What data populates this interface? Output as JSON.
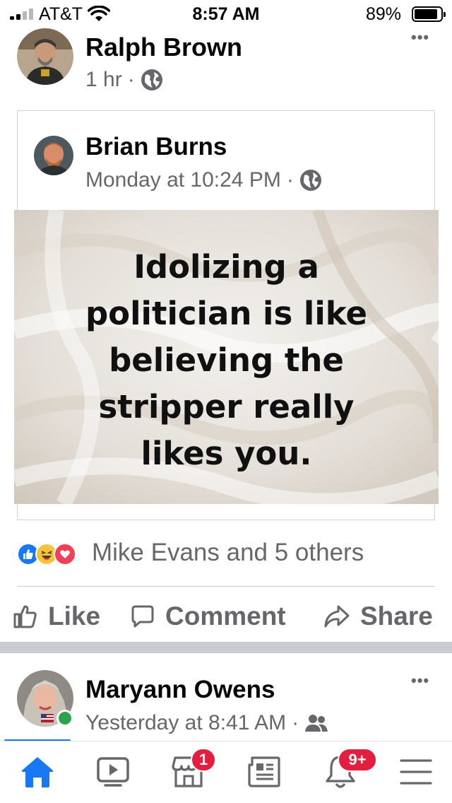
{
  "status_bar": {
    "carrier": "AT&T",
    "time": "8:57 AM",
    "battery_percent": "89%",
    "battery_level": 0.89,
    "signal_bars": 2
  },
  "post": {
    "author": "Ralph Brown",
    "timestamp": "1 hr",
    "separator": "·",
    "audience_icon": "globe-icon",
    "more_label": "•••",
    "shared": {
      "author": "Brian Burns",
      "timestamp": "Monday at 10:24 PM",
      "separator": "·",
      "audience_icon": "globe-icon",
      "image_text_lines": [
        "Idolizing a",
        "politician is like",
        "believing the",
        "stripper really",
        "likes you."
      ]
    },
    "reactions": {
      "icons": [
        "like-reaction-icon",
        "haha-reaction-icon",
        "love-reaction-icon"
      ],
      "summary": "Mike Evans and 5 others"
    },
    "actions": {
      "like": "Like",
      "comment": "Comment",
      "share": "Share"
    }
  },
  "next_post": {
    "author": "Maryann Owens",
    "timestamp": "Yesterday at 8:41 AM",
    "separator": "·",
    "audience_icon": "friends-icon",
    "online": true,
    "more_label": "•••"
  },
  "tab_bar": {
    "tabs": [
      {
        "name": "home",
        "icon": "home-icon",
        "active": true
      },
      {
        "name": "watch",
        "icon": "video-icon"
      },
      {
        "name": "marketplace",
        "icon": "marketplace-icon",
        "badge": "1"
      },
      {
        "name": "news",
        "icon": "news-icon"
      },
      {
        "name": "notifications",
        "icon": "bell-icon",
        "badge": "9+"
      },
      {
        "name": "menu",
        "icon": "menu-icon"
      }
    ]
  },
  "colors": {
    "brand_blue": "#1877f2",
    "secondary_text": "#65676b",
    "badge_red": "#e41e3f",
    "online_green": "#31a24c"
  }
}
